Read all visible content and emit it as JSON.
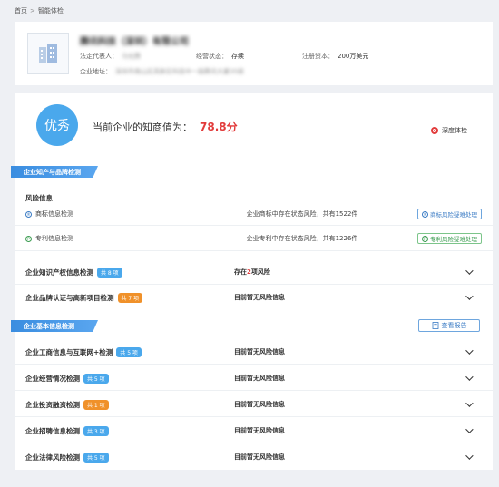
{
  "breadcrumb": {
    "home": "首页",
    "separator": ">",
    "current": "智能体检"
  },
  "company": {
    "name": "腾讯科技（深圳）有限公司",
    "legal_rep_label": "法定代表人：",
    "legal_rep_value": "马化腾",
    "status_label": "经营状态：",
    "status_value": "存续",
    "capital_label": "注册资本：",
    "capital_value": "200万美元",
    "address_label": "企业地址：",
    "address_value": "深圳市南山区高新区科技中一路腾讯大厦35层"
  },
  "summary": {
    "grade": "优秀",
    "score_label": "当前企业的知商值为：",
    "score_value": "78.8分",
    "deep_check_label": "深度体检"
  },
  "section_ip": {
    "title": "企业知产与品牌检测",
    "risk_title": "风险信息",
    "risks": [
      {
        "label": "商标信息检测",
        "desc": "企业商标中存在状态风险，共有1522件",
        "button": "商标风险疑难处理",
        "icon": "trademark-icon"
      },
      {
        "label": "专利信息检测",
        "desc": "企业专利中存在状态风险，共有1226件",
        "button": "专利风险疑难处理",
        "icon": "patent-icon"
      }
    ],
    "checks": [
      {
        "name": "企业知识产权信息检测",
        "badge": "共 8 项",
        "badge_color": "blue",
        "status_pre": "存在",
        "status_hl": "2",
        "status_post": "项风险"
      },
      {
        "name": "企业品牌认证与高新项目检测",
        "badge": "共 7 项",
        "badge_color": "orange",
        "status": "目前暂无风险信息"
      }
    ]
  },
  "section_basic": {
    "title": "企业基本信息检测",
    "report_button": "查看报告",
    "checks": [
      {
        "name": "企业工商信息与互联网+检测",
        "badge": "共 5 项",
        "badge_color": "blue",
        "status": "目前暂无风险信息"
      },
      {
        "name": "企业经营情况检测",
        "badge": "共 5 项",
        "badge_color": "blue",
        "status": "目前暂无风险信息"
      },
      {
        "name": "企业投资融资检测",
        "badge": "共 1 项",
        "badge_color": "orange",
        "status": "目前暂无风险信息"
      },
      {
        "name": "企业招聘信息检测",
        "badge": "共 3 项",
        "badge_color": "blue",
        "status": "目前暂无风险信息"
      },
      {
        "name": "企业法律风险检测",
        "badge": "共 5 项",
        "badge_color": "blue",
        "status": "目前暂无风险信息"
      }
    ]
  },
  "colors": {
    "accent": "#4aa8ec",
    "danger": "#e23b3b",
    "badge_orange": "#f0912a"
  }
}
